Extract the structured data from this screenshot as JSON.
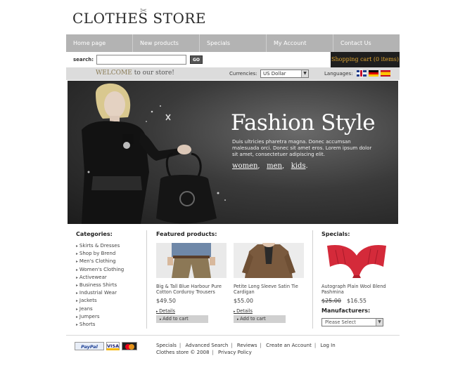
{
  "logo": {
    "text": "CLOTHES STORE"
  },
  "nav": {
    "items": [
      "Home page",
      "New products",
      "Specials",
      "My Account",
      "Contact Us"
    ]
  },
  "search": {
    "label": "search:",
    "value": "",
    "go_label": "GO"
  },
  "cart": {
    "label": "Shopping cart (0 items)"
  },
  "welcome": {
    "prefix": "WELCOME",
    "suffix": " to our store!"
  },
  "currencies": {
    "label": "Currencies:",
    "selected": "US Dollar"
  },
  "languages": {
    "label": "Languages:"
  },
  "hero": {
    "title": "Fashion Style",
    "text": "Duis ultricies pharetra magna. Donec accumsan malesuada orci. Donec sit amet eros. Lorem ipsum dolor sit amet, consectetuer adipiscing elit.",
    "links": [
      "women",
      "men",
      "kids"
    ]
  },
  "categories": {
    "title": "Categories:",
    "items": [
      "Skirts & Dresses",
      "Shop by Brend",
      "Men's Clothing",
      "Women's Clothing",
      "Activewear",
      "Business Shirts",
      "Industrial Wear",
      "Jackets",
      "Jeans",
      "Jumpers",
      "Shorts"
    ]
  },
  "featured": {
    "title": "Featured products:",
    "products": [
      {
        "name": "Big & Tall Blue Harbour Pure Cotton Corduroy Trousers",
        "price": "$49.50",
        "details": "Details",
        "add": "Add to cart"
      },
      {
        "name": "Petite Long Sleeve Satin Tie Cardigan",
        "price": "$55.00",
        "details": "Details",
        "add": "Add to cart"
      }
    ]
  },
  "specials": {
    "title": "Specials:",
    "product": {
      "name": "Autograph Plain Wool Blend Pashmina",
      "old_price": "$25.00",
      "price": "$16.55"
    }
  },
  "manufacturers": {
    "title": "Manufacturers:",
    "selected": "Please Select"
  },
  "footer": {
    "payments": [
      "PayPal",
      "VISA"
    ],
    "links": [
      "Specials",
      "Advanced Search",
      "Reviews",
      "Create an Account",
      "Log In"
    ],
    "copyright": "Clothes store © 2008",
    "privacy": "Privacy Policy"
  }
}
